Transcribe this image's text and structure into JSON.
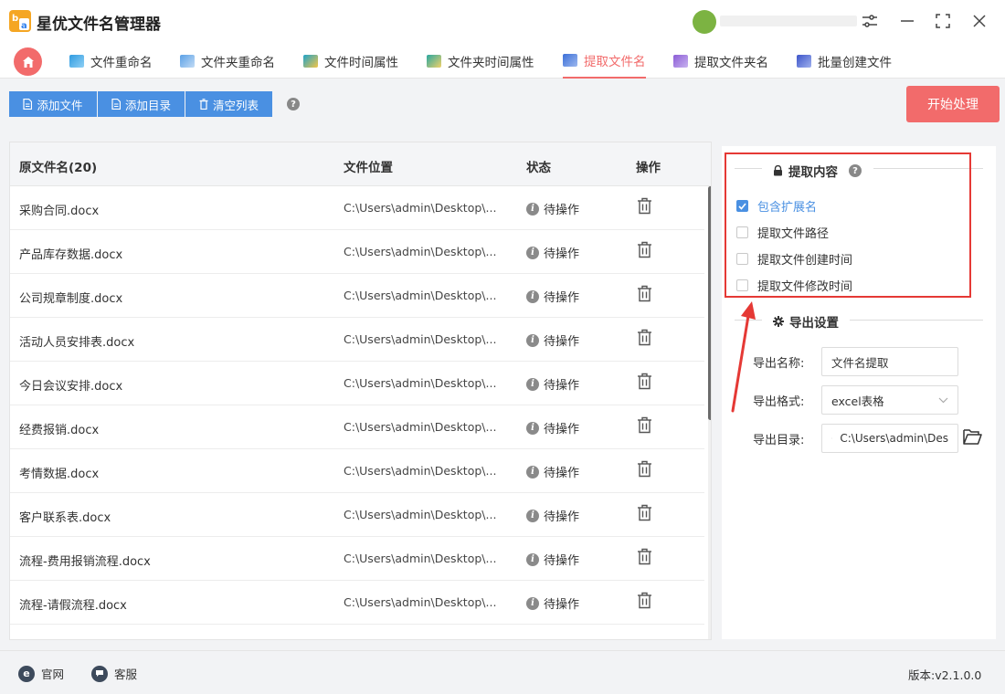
{
  "app": {
    "title": "星优文件名管理器"
  },
  "nav": {
    "tabs": [
      {
        "label": "文件重命名",
        "icon": "rename-file-icon"
      },
      {
        "label": "文件夹重命名",
        "icon": "rename-folder-icon"
      },
      {
        "label": "文件时间属性",
        "icon": "file-time-icon"
      },
      {
        "label": "文件夹时间属性",
        "icon": "folder-time-icon"
      },
      {
        "label": "提取文件名",
        "icon": "extract-filename-icon",
        "active": true
      },
      {
        "label": "提取文件夹名",
        "icon": "extract-foldername-icon"
      },
      {
        "label": "批量创建文件",
        "icon": "batch-create-icon"
      }
    ]
  },
  "toolbar": {
    "add_file": "添加文件",
    "add_dir": "添加目录",
    "clear_list": "清空列表",
    "start": "开始处理"
  },
  "table": {
    "headers": {
      "name": "原文件名(20)",
      "location": "文件位置",
      "status": "状态",
      "action": "操作"
    },
    "rows": [
      {
        "name": "采购合同.docx",
        "path": "C:\\Users\\admin\\Desktop\\...",
        "status": "待操作"
      },
      {
        "name": "产品库存数据.docx",
        "path": "C:\\Users\\admin\\Desktop\\...",
        "status": "待操作"
      },
      {
        "name": "公司规章制度.docx",
        "path": "C:\\Users\\admin\\Desktop\\...",
        "status": "待操作"
      },
      {
        "name": "活动人员安排表.docx",
        "path": "C:\\Users\\admin\\Desktop\\...",
        "status": "待操作"
      },
      {
        "name": "今日会议安排.docx",
        "path": "C:\\Users\\admin\\Desktop\\...",
        "status": "待操作"
      },
      {
        "name": "经费报销.docx",
        "path": "C:\\Users\\admin\\Desktop\\...",
        "status": "待操作"
      },
      {
        "name": "考情数据.docx",
        "path": "C:\\Users\\admin\\Desktop\\...",
        "status": "待操作"
      },
      {
        "name": "客户联系表.docx",
        "path": "C:\\Users\\admin\\Desktop\\...",
        "status": "待操作"
      },
      {
        "name": "流程-费用报销流程.docx",
        "path": "C:\\Users\\admin\\Desktop\\...",
        "status": "待操作"
      },
      {
        "name": "流程-请假流程.docx",
        "path": "C:\\Users\\admin\\Desktop\\...",
        "status": "待操作"
      }
    ]
  },
  "extract": {
    "title": "提取内容",
    "options": [
      {
        "label": "包含扩展名",
        "checked": true
      },
      {
        "label": "提取文件路径",
        "checked": false
      },
      {
        "label": "提取文件创建时间",
        "checked": false
      },
      {
        "label": "提取文件修改时间",
        "checked": false
      }
    ]
  },
  "export": {
    "title": "导出设置",
    "name_label": "导出名称:",
    "name_value": "文件名提取",
    "format_label": "导出格式:",
    "format_value": "excel表格",
    "dir_label": "导出目录:",
    "dir_value": "C:\\Users\\admin\\Des"
  },
  "statusbar": {
    "website": "官网",
    "support": "客服",
    "version": "版本:v2.1.0.0"
  },
  "colors": {
    "accent": "#f26b6b",
    "primary": "#4a90e2",
    "highlight_box": "#e53935"
  }
}
